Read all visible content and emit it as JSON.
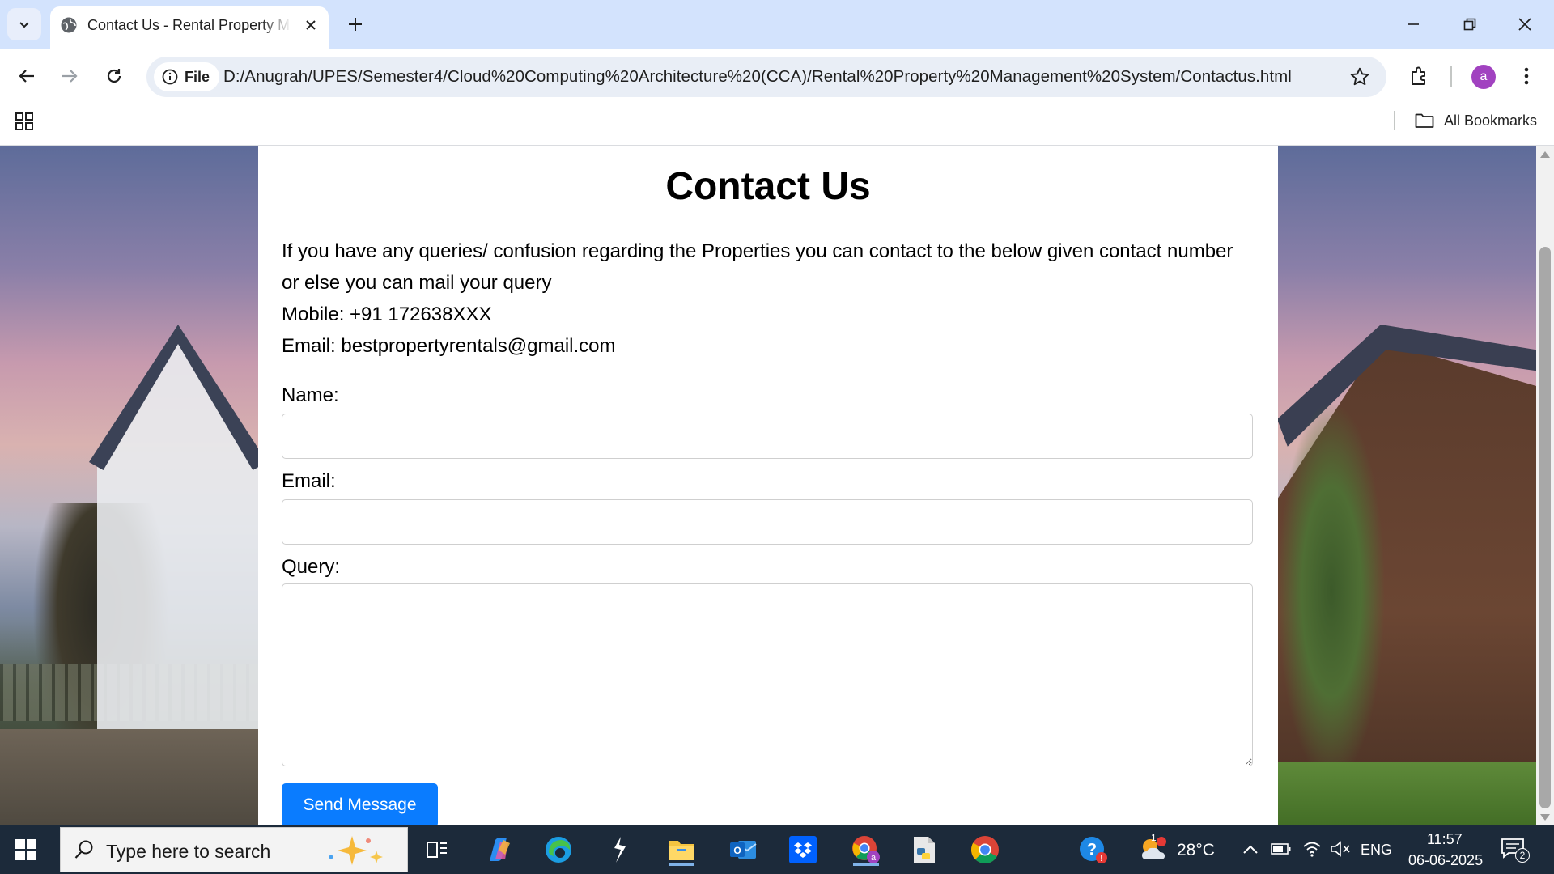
{
  "browser": {
    "tab": {
      "title": "Contact Us - Rental Property M"
    },
    "address": {
      "chip": "File",
      "url": "D:/Anugrah/UPES/Semester4/Cloud%20Computing%20Architecture%20(CCA)/Rental%20Property%20Management%20System/Contactus.html"
    },
    "profile_initial": "a",
    "bookmarks": {
      "all_label": "All Bookmarks"
    }
  },
  "page": {
    "title": "Contact Us",
    "intro_line1": "If you have any queries/ confusion regarding the Properties you can contact to the below given contact number",
    "intro_line2": "or else you can mail your query",
    "mobile": "Mobile: +91 172638XXX",
    "email": "Email: bestpropertyrentals@gmail.com",
    "form": {
      "name_label": "Name:",
      "name_value": "",
      "email_label": "Email:",
      "email_value": "",
      "query_label": "Query:",
      "query_value": "",
      "submit_label": "Send Message"
    }
  },
  "taskbar": {
    "search_placeholder": "Type here to search",
    "weather": "28°C",
    "weather_badge": "1",
    "language": "ENG",
    "time": "11:57",
    "date": "06-06-2025",
    "notifications": "2"
  },
  "colors": {
    "tab_strip": "#d3e3fd",
    "accent_button": "#0a7cff",
    "avatar": "#a142c0",
    "taskbar": "#1c2a3a"
  }
}
